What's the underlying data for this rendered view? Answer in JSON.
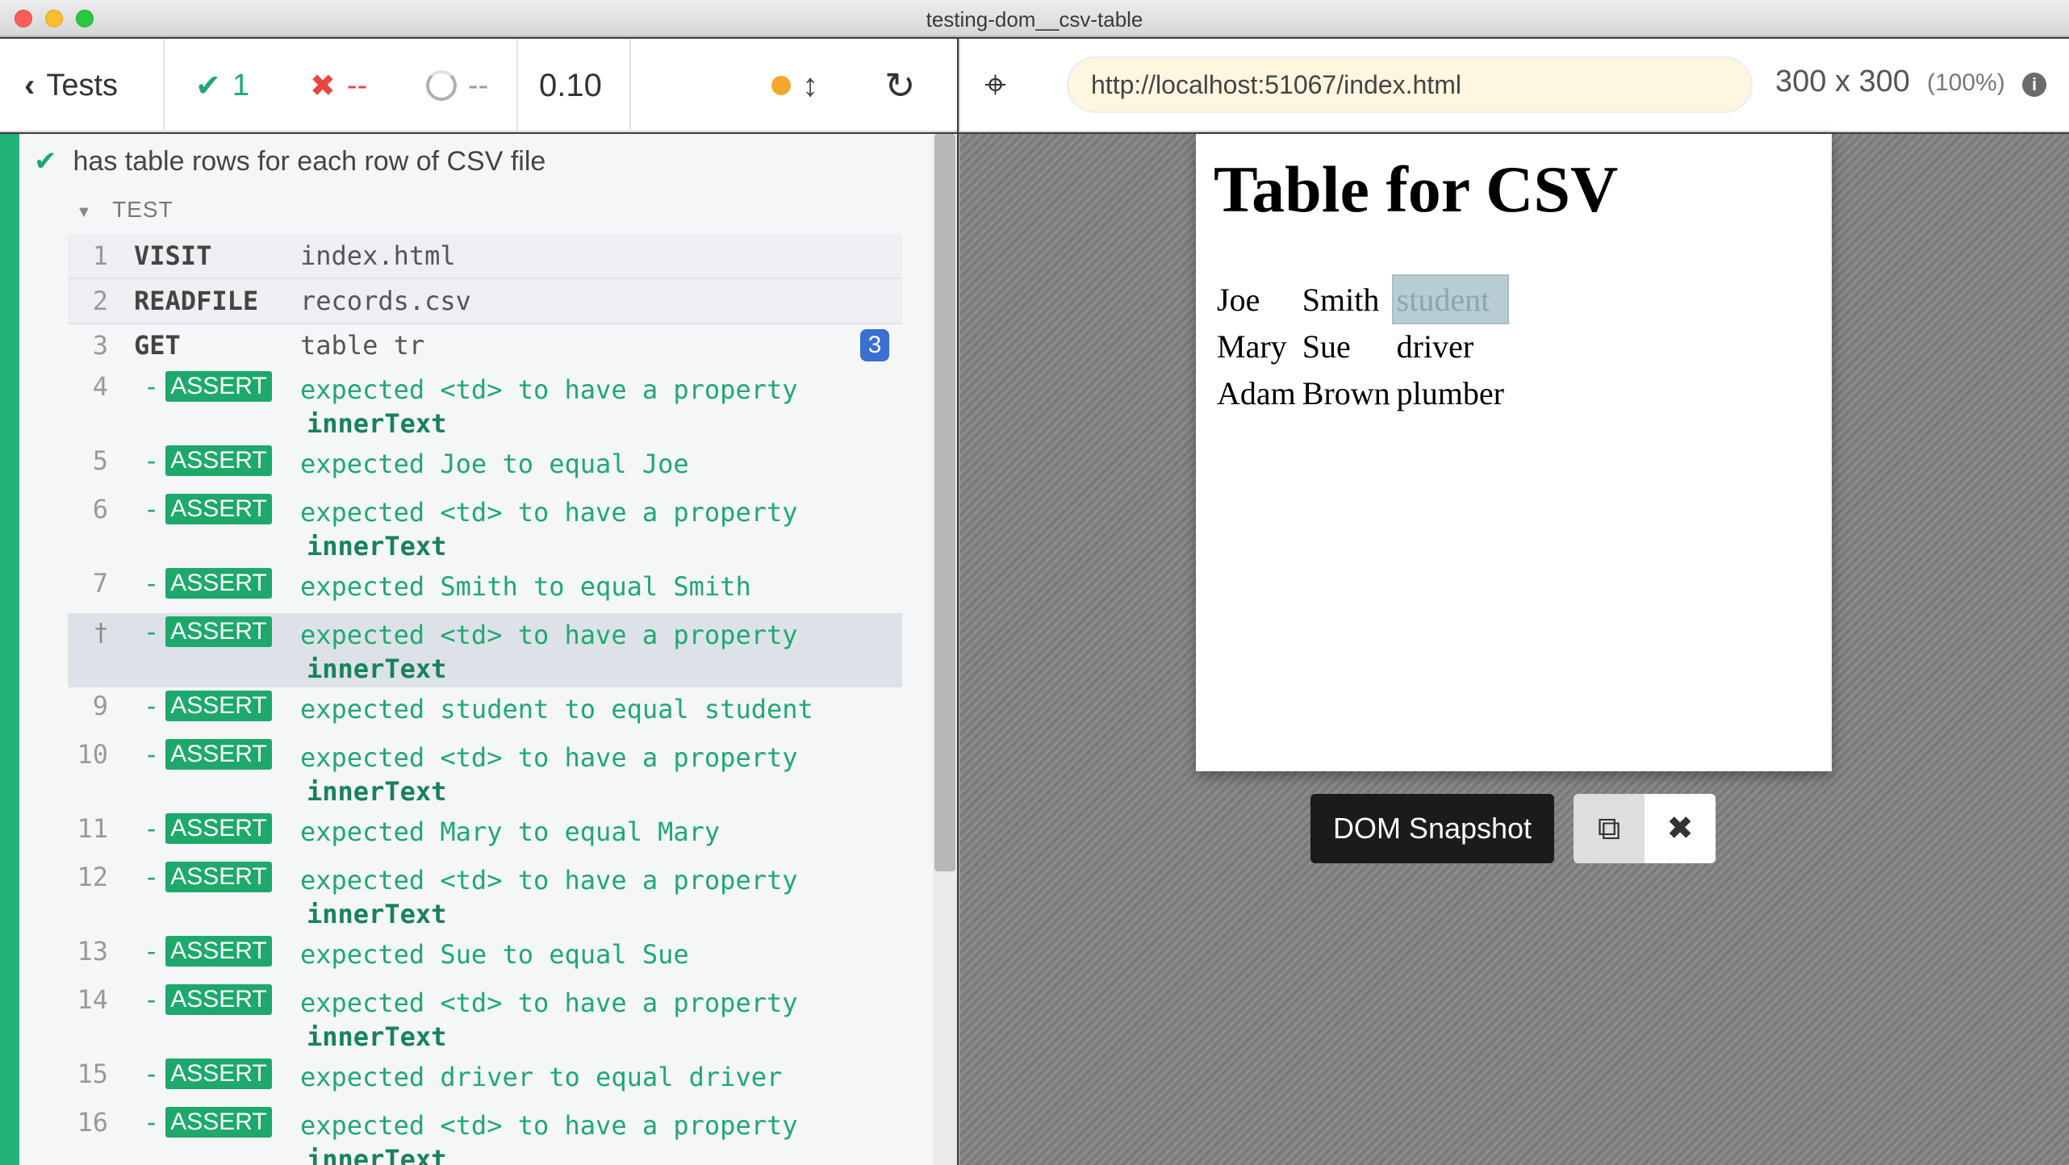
{
  "window": {
    "title": "testing-dom__csv-table"
  },
  "reporter": {
    "tests_label": "Tests",
    "passed_count": "1",
    "failed_count": "--",
    "pending_count": "--",
    "duration": "0.10",
    "test_title": "has table rows for each row of CSV file",
    "hook_title": "TEST",
    "commands": [
      {
        "num": "1",
        "name": "VISIT",
        "message": "index.html"
      },
      {
        "num": "2",
        "name": "READFILE",
        "message": "records.csv"
      },
      {
        "num": "3",
        "name": "GET",
        "message": "table tr",
        "badge": "3"
      }
    ],
    "assertions": [
      {
        "num": "4",
        "badge": "ASSERT",
        "l1": "expected <td> to have a property",
        "l2": "innerText"
      },
      {
        "num": "5",
        "badge": "ASSERT",
        "l1": "expected Joe to equal Joe",
        "l2": ""
      },
      {
        "num": "6",
        "badge": "ASSERT",
        "l1": "expected <td> to have a property",
        "l2": "innerText"
      },
      {
        "num": "7",
        "badge": "ASSERT",
        "l1": "expected Smith to equal Smith",
        "l2": ""
      },
      {
        "num": "",
        "badge": "ASSERT",
        "l1": "expected <td> to have a property",
        "l2": "innerText",
        "pinned": true
      },
      {
        "num": "9",
        "badge": "ASSERT",
        "l1": "expected student to equal student",
        "l2": ""
      },
      {
        "num": "10",
        "badge": "ASSERT",
        "l1": "expected <td> to have a property",
        "l2": "innerText"
      },
      {
        "num": "11",
        "badge": "ASSERT",
        "l1": "expected Mary to equal Mary",
        "l2": ""
      },
      {
        "num": "12",
        "badge": "ASSERT",
        "l1": "expected <td> to have a property",
        "l2": "innerText"
      },
      {
        "num": "13",
        "badge": "ASSERT",
        "l1": "expected Sue to equal Sue",
        "l2": ""
      },
      {
        "num": "14",
        "badge": "ASSERT",
        "l1": "expected <td> to have a property",
        "l2": "innerText"
      },
      {
        "num": "15",
        "badge": "ASSERT",
        "l1": "expected driver to equal driver",
        "l2": ""
      },
      {
        "num": "16",
        "badge": "ASSERT",
        "l1": "expected <td> to have a property",
        "l2": "innerText"
      }
    ]
  },
  "aut": {
    "url": "http://localhost:51067/index.html",
    "viewport_size": "300 x 300",
    "viewport_scale": "(100%)",
    "page_heading": "Table for CSV",
    "table": [
      [
        "Joe",
        "Smith",
        "student"
      ],
      [
        "Mary",
        "Sue",
        "driver"
      ],
      [
        "Adam",
        "Brown",
        "plumber"
      ]
    ],
    "snapshot_label": "DOM Snapshot"
  },
  "colors": {
    "pass": "#1fa971",
    "fail": "#e5483d",
    "accent_strip": "#22b27a",
    "url_bg": "#fff6df"
  }
}
